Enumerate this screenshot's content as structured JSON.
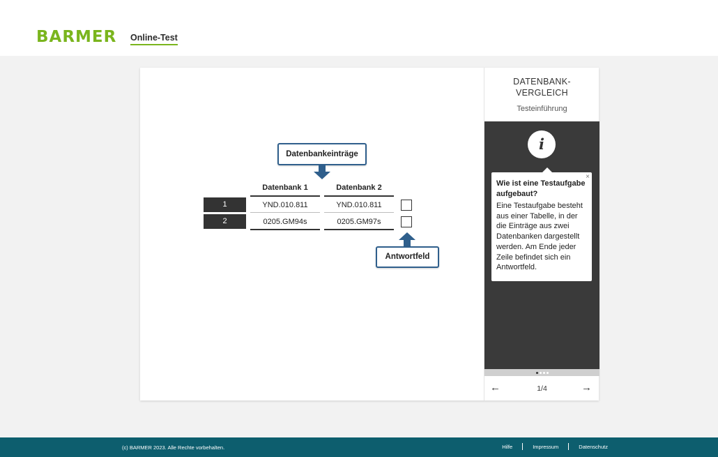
{
  "header": {
    "logo": "BARMER",
    "nav_label": "Online-Test"
  },
  "stage": {
    "callout_top": "Datenbankeinträge",
    "callout_bottom": "Antwortfeld",
    "columns": [
      "Datenbank 1",
      "Datenbank 2"
    ],
    "rows": [
      {
        "num": "1",
        "db1": "YND.010.811",
        "db2": "YND.010.811"
      },
      {
        "num": "2",
        "db1": "0205.GM94s",
        "db2": "0205.GM97s"
      }
    ]
  },
  "panel": {
    "title": "DATENBANK-\nVERGLEICH",
    "subtitle": "Testeinführung",
    "info_icon": "i",
    "tooltip": {
      "title": "Wie ist eine Testaufgabe aufgebaut?",
      "text": "Eine Testaufgabe besteht aus einer Tabelle, in der die Einträge aus zwei Datenbanken dargestellt werden. Am Ende jeder Zeile befindet sich ein Antwortfeld.",
      "close": "×"
    },
    "dots": {
      "count": 4,
      "active": 1
    },
    "nav": {
      "prev": "←",
      "next": "→",
      "page": "1/4"
    }
  },
  "footer": {
    "copyright": "(c) BARMER 2023. Alle Rechte vorbehalten.",
    "links": [
      "Hilfe",
      "Impressum",
      "Datenschutz"
    ]
  },
  "colors": {
    "brand_green": "#7ab51d",
    "callout_blue": "#2f5f8c",
    "footer_teal": "#0d5e6e",
    "panel_dark": "#3a3a3a"
  }
}
